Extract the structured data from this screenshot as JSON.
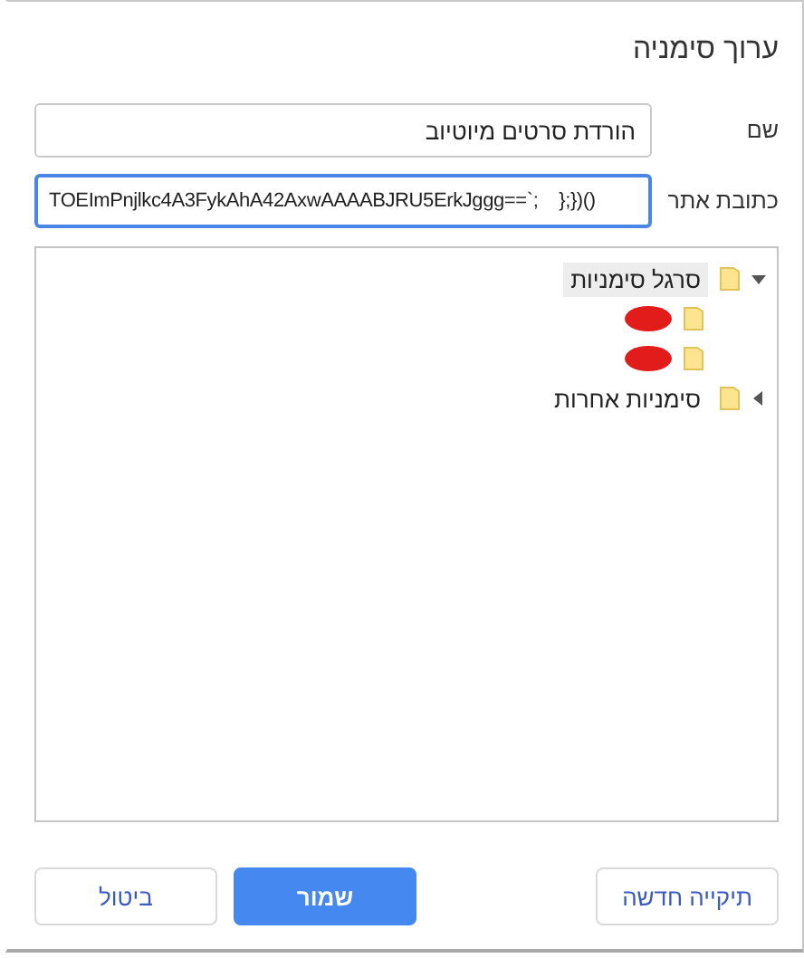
{
  "dialog": {
    "title": "ערוך סימניה"
  },
  "fields": [
    {
      "label": "שם",
      "value": "הורדת סרטים מיוטיוב",
      "focused": false,
      "kind": "text"
    },
    {
      "label": "כתובת אתר",
      "value": "TOEImPnjlkc4A3FykAhA42AxwAAAABJRU5ErkJggg==`;    };})()",
      "focused": true,
      "kind": "url"
    }
  ],
  "tree": [
    {
      "label": "סרגל סימניות",
      "expanded": true,
      "selected": true,
      "children": [
        {
          "redacted": true
        },
        {
          "redacted": true
        }
      ]
    },
    {
      "label": "סימניות אחרות",
      "expanded": false,
      "selected": false
    }
  ],
  "buttons": [
    {
      "label": "תיקייה חדשה",
      "kind": "secondary"
    },
    {
      "label": "שמור",
      "kind": "primary"
    },
    {
      "label": "ביטול",
      "kind": "secondary"
    }
  ]
}
